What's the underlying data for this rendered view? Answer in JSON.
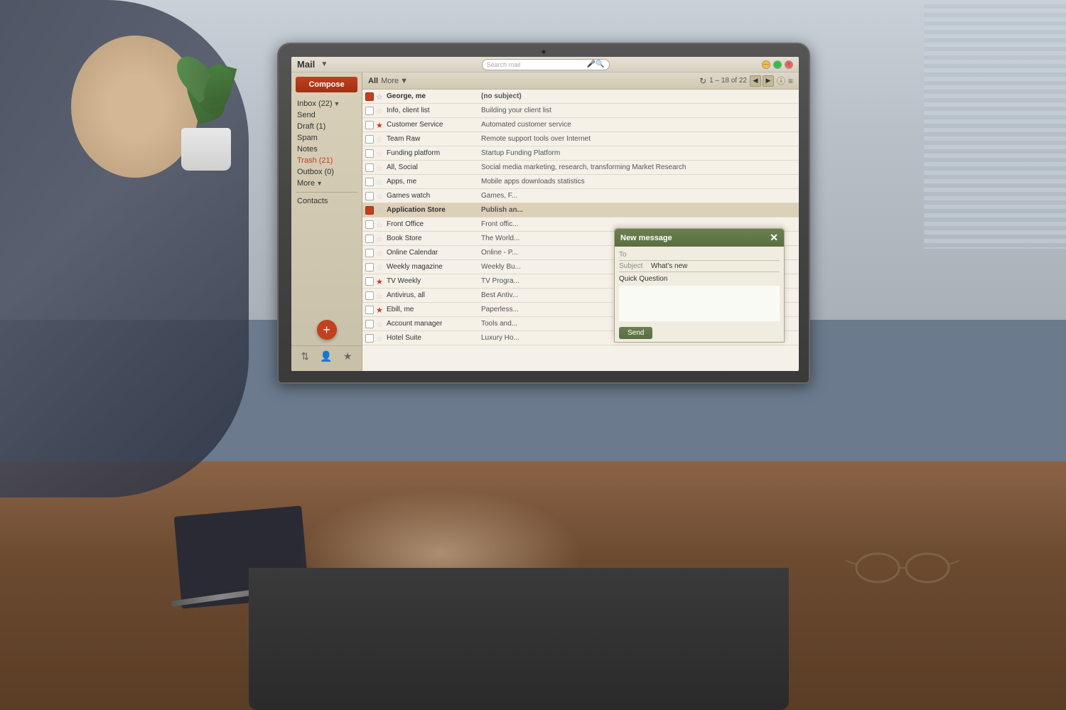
{
  "scene": {
    "title": "Person using laptop with email client"
  },
  "mail_app": {
    "title": "Mail",
    "search_placeholder": "Search mail",
    "window_controls": {
      "minimize": "—",
      "maximize": "□",
      "close": "✕"
    },
    "toolbar": {
      "all_label": "All",
      "more_label": "More",
      "refresh_icon": "↻",
      "count": "1 – 18 of 22",
      "info_icon": "ⓘ",
      "menu_icon": "≡"
    },
    "sidebar": {
      "compose_label": "Compose",
      "items": [
        {
          "label": "Inbox",
          "count": "(22)",
          "has_dropdown": true
        },
        {
          "label": "Send",
          "count": "",
          "has_dropdown": false
        },
        {
          "label": "Draft",
          "count": "(1)",
          "has_dropdown": false
        },
        {
          "label": "Spam",
          "count": "",
          "has_dropdown": false
        },
        {
          "label": "Notes",
          "count": "",
          "has_dropdown": false
        },
        {
          "label": "Trash",
          "count": "(21)",
          "has_dropdown": false,
          "is_active": true
        },
        {
          "label": "Outbox",
          "count": "(0)",
          "has_dropdown": false
        },
        {
          "label": "More",
          "count": "",
          "has_dropdown": true
        }
      ],
      "contacts_label": "Contacts",
      "add_icon": "+",
      "bottom_icons": [
        "≡",
        "👤",
        "★"
      ]
    },
    "emails": [
      {
        "checked": true,
        "starred": false,
        "sender": "George, me",
        "subject": "(no subject)",
        "unread": true
      },
      {
        "checked": false,
        "starred": false,
        "sender": "Info, client list",
        "subject": "Building your client list",
        "unread": false
      },
      {
        "checked": false,
        "starred": true,
        "sender": "Customer Service",
        "subject": "Automated customer service",
        "unread": false
      },
      {
        "checked": false,
        "starred": false,
        "sender": "Team Raw",
        "subject": "Remote support tools over Internet",
        "unread": false
      },
      {
        "checked": false,
        "starred": false,
        "sender": "Funding platform",
        "subject": "Startup Funding Platform",
        "unread": false
      },
      {
        "checked": false,
        "starred": false,
        "sender": "All, Social",
        "subject": "Social media marketing, research, transforming Market Research",
        "unread": false
      },
      {
        "checked": false,
        "starred": false,
        "sender": "Apps, me",
        "subject": "Mobile apps downloads statistics",
        "unread": false
      },
      {
        "checked": false,
        "starred": false,
        "sender": "Games watch",
        "subject": "Games, F...",
        "unread": false
      },
      {
        "checked": true,
        "starred": false,
        "sender": "Application Store",
        "subject": "Publish an...",
        "unread": true
      },
      {
        "checked": false,
        "starred": false,
        "sender": "Front Office",
        "subject": "Front offic...",
        "unread": false
      },
      {
        "checked": false,
        "starred": false,
        "sender": "Book Store",
        "subject": "The World...",
        "unread": false
      },
      {
        "checked": false,
        "starred": false,
        "sender": "Online Calendar",
        "subject": "Online - P...",
        "unread": false
      },
      {
        "checked": false,
        "starred": false,
        "sender": "Weekly magazine",
        "subject": "Weekly Bu...",
        "unread": false
      },
      {
        "checked": false,
        "starred": true,
        "sender": "TV Weekly",
        "subject": "TV Progra...",
        "unread": false
      },
      {
        "checked": false,
        "starred": false,
        "sender": "Antivirus, all",
        "subject": "Best Antiv...",
        "unread": false
      },
      {
        "checked": false,
        "starred": true,
        "sender": "Ebill, me",
        "subject": "Paperless...",
        "unread": false
      },
      {
        "checked": false,
        "starred": false,
        "sender": "Account manager",
        "subject": "Tools and...",
        "unread": false
      },
      {
        "checked": false,
        "starred": false,
        "sender": "Hotel Suite",
        "subject": "Luxury Ho...",
        "unread": false
      }
    ],
    "new_message": {
      "header_label": "New message",
      "close_icon": "✕",
      "to_label": "To",
      "to_value": "",
      "subject_label": "Subject",
      "subject_value": "What's new",
      "quick_question_label": "Quick Question",
      "send_label": "Send"
    }
  }
}
